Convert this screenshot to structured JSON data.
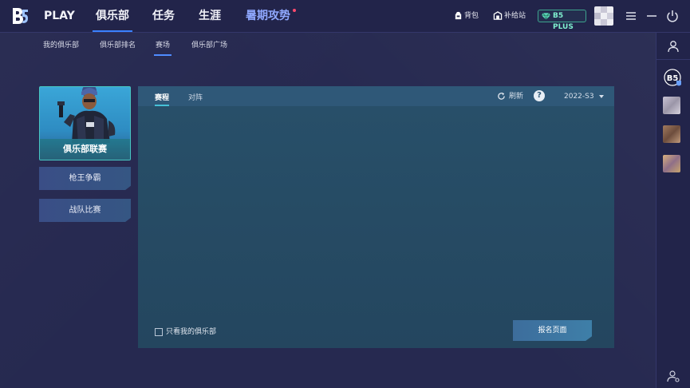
{
  "app": {
    "logo_text": "B5"
  },
  "topnav": {
    "items": [
      {
        "label": "PLAY"
      },
      {
        "label": "俱乐部"
      },
      {
        "label": "任务"
      },
      {
        "label": "生涯"
      },
      {
        "label": "暑期攻势"
      }
    ],
    "active_index": 1
  },
  "toolbar": {
    "backpack_label": "背包",
    "supply_label": "补给站",
    "plus_label": "B5 PLUS"
  },
  "subnav": {
    "items": [
      {
        "label": "我的俱乐部"
      },
      {
        "label": "俱乐部排名"
      },
      {
        "label": "赛场"
      },
      {
        "label": "俱乐部广场"
      }
    ],
    "active_index": 2
  },
  "sidebar_left": {
    "league_card_label": "俱乐部联赛",
    "buttons": [
      {
        "label": "枪王争霸"
      },
      {
        "label": "战队比赛"
      }
    ]
  },
  "panel": {
    "tabs": [
      {
        "label": "赛程"
      },
      {
        "label": "对阵"
      }
    ],
    "active_tab": 0,
    "refresh_label": "刷新",
    "help_label": "?",
    "season_value": "2022-S3",
    "checkbox_label": "只看我的俱乐部",
    "checkbox_checked": false,
    "signup_button_label": "报名页面"
  },
  "colors": {
    "accent_blue": "#3a82ff",
    "teal_accent": "#46c1d7",
    "plus_green": "#7ff0cf",
    "promo_dot": "#ff4b6e"
  }
}
